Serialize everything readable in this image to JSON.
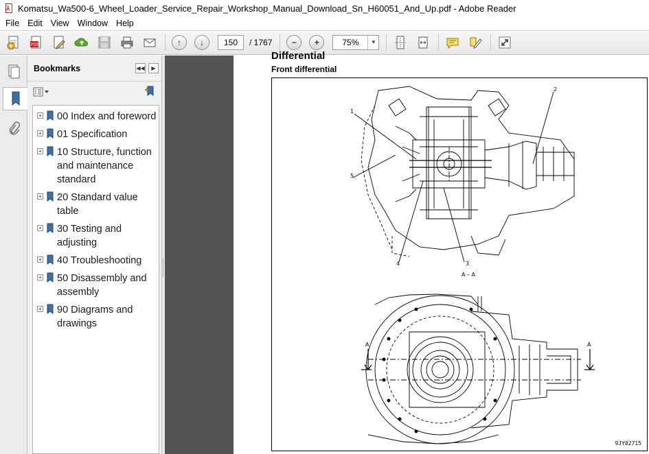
{
  "window": {
    "title": "Komatsu_Wa500-6_Wheel_Loader_Service_Repair_Workshop_Manual_Download_Sn_H60051_And_Up.pdf - Adobe Reader"
  },
  "menu": [
    "File",
    "Edit",
    "View",
    "Window",
    "Help"
  ],
  "toolbar": {
    "current_page": "150",
    "total_pages": "/ 1767",
    "zoom": "75%",
    "icons": [
      "create-pdf-icon",
      "export-pdf-icon",
      "edit-pdf-icon",
      "upload-cloud-icon",
      "save-icon",
      "print-icon",
      "email-icon",
      "previous-page-icon",
      "next-page-icon",
      "zoom-out-icon",
      "zoom-in-icon",
      "fit-page-icon",
      "fit-width-icon",
      "comment-icon",
      "highlight-icon",
      "expand-icon"
    ]
  },
  "bookmarks": {
    "title": "Bookmarks",
    "items": [
      "00 Index and foreword",
      "01 Specification",
      "10 Structure, function and maintenance standard",
      "20 Standard value table",
      "30 Testing and adjusting",
      "40 Troubleshooting",
      "50 Disassembly and assembly",
      "90 Diagrams and drawings"
    ]
  },
  "document": {
    "heading": "Differential",
    "subheading": "Front differential",
    "figure": {
      "callouts": [
        "1",
        "2",
        "3",
        "4",
        "5"
      ],
      "section_label": "A – A",
      "section_marker": "A",
      "code": "9JY02715"
    }
  },
  "colors": {
    "doc_background": "#535353",
    "panel_background": "#f0f0f0",
    "toolbar_background": "#ececec",
    "pdf_icon_red": "#c02020"
  }
}
